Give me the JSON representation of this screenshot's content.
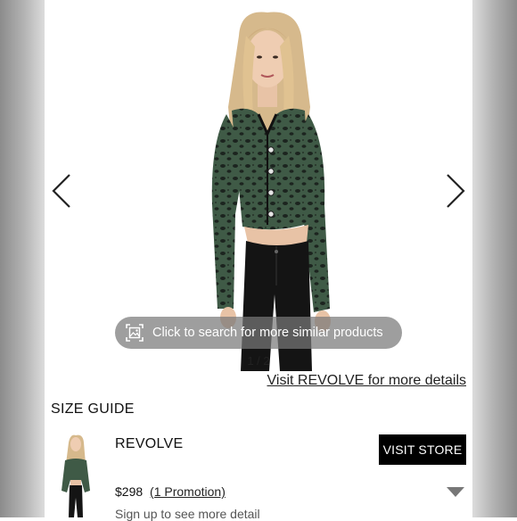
{
  "gallery": {
    "search_label": "Click to search for more similar products",
    "counter": "1 / 2",
    "icons": {
      "prev": "chevron-left-icon",
      "next": "chevron-right-icon",
      "search": "image-search-icon"
    }
  },
  "links": {
    "visit_details": "Visit REVOLVE for more details"
  },
  "size_guide": "SIZE GUIDE",
  "store": {
    "name": "REVOLVE",
    "button": "VISIT STORE",
    "price": "$298",
    "promotion": "(1 Promotion)",
    "signup": "Sign up to see more detail"
  },
  "colors": {
    "button_bg": "#000000",
    "pill_bg": "#787878"
  }
}
